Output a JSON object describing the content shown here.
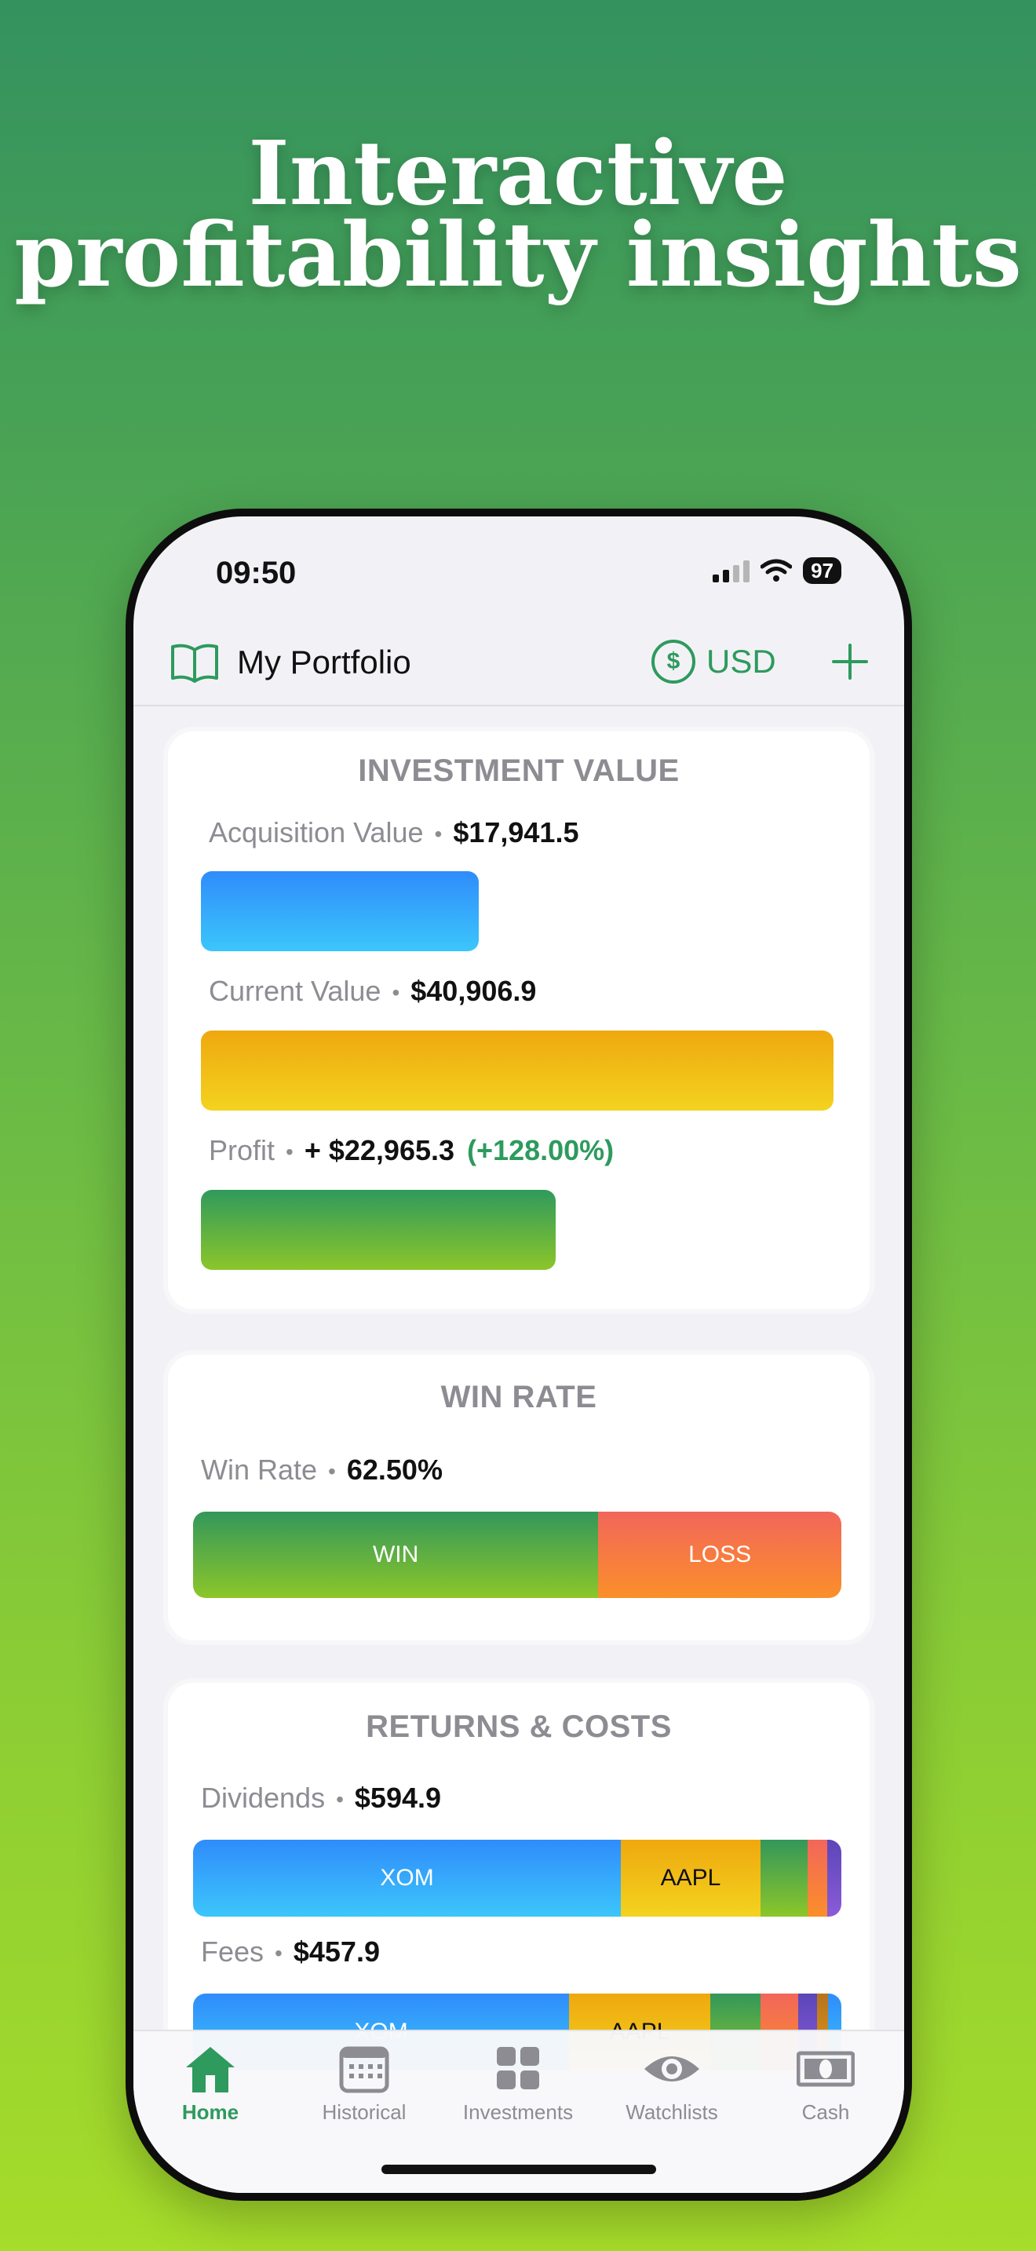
{
  "headline": {
    "line1": "Interactive",
    "line2": "profitability insights"
  },
  "status_bar": {
    "time": "09:50",
    "battery": "97"
  },
  "navbar": {
    "title": "My Portfolio",
    "currency_symbol": "$",
    "currency": "USD"
  },
  "investment_value": {
    "title": "INVESTMENT VALUE",
    "acquisition": {
      "label": "Acquisition Value",
      "value": "$17,941.5"
    },
    "current": {
      "label": "Current Value",
      "value": "$40,906.9"
    },
    "profit": {
      "label": "Profit",
      "value": "+ $22,965.3",
      "percent": "(+128.00%)"
    }
  },
  "win_rate": {
    "title": "WIN RATE",
    "label": "Win Rate",
    "value": "62.50%",
    "win_label": "WIN",
    "loss_label": "LOSS",
    "win_fraction": 0.625
  },
  "returns_costs": {
    "title": "RETURNS & COSTS",
    "dividends": {
      "label": "Dividends",
      "value": "$594.9",
      "segments": [
        {
          "label": "XOM",
          "fraction": 0.66,
          "color": "#2f8cfb"
        },
        {
          "label": "AAPL",
          "fraction": 0.215,
          "color": "#efa80e"
        },
        {
          "label": "",
          "fraction": 0.073,
          "color": "#33975a"
        },
        {
          "label": "",
          "fraction": 0.03,
          "color": "#f2665a"
        },
        {
          "label": "",
          "fraction": 0.022,
          "color": "#5b46b8"
        }
      ]
    },
    "fees": {
      "label": "Fees",
      "value": "$457.9",
      "segments": [
        {
          "label": "XOM",
          "fraction": 0.58,
          "color": "#2f8cfb"
        },
        {
          "label": "AAPL",
          "fraction": 0.218,
          "color": "#efa80e"
        },
        {
          "label": "",
          "fraction": 0.077,
          "color": "#33975a"
        },
        {
          "label": "",
          "fraction": 0.058,
          "color": "#f2665a"
        },
        {
          "label": "",
          "fraction": 0.03,
          "color": "#5b46b8"
        },
        {
          "label": "",
          "fraction": 0.017,
          "color": "#b7731c"
        },
        {
          "label": "",
          "fraction": 0.02,
          "color": "#2f8cfb"
        }
      ]
    }
  },
  "tabs": [
    {
      "label": "Home",
      "icon": "home-icon",
      "active": true
    },
    {
      "label": "Historical",
      "icon": "calendar-icon",
      "active": false
    },
    {
      "label": "Investments",
      "icon": "grid-icon",
      "active": false
    },
    {
      "label": "Watchlists",
      "icon": "eye-icon",
      "active": false
    },
    {
      "label": "Cash",
      "icon": "banknote-icon",
      "active": false
    }
  ],
  "colors": {
    "accent": "#2e9a5e",
    "muted": "#8c8c92"
  }
}
